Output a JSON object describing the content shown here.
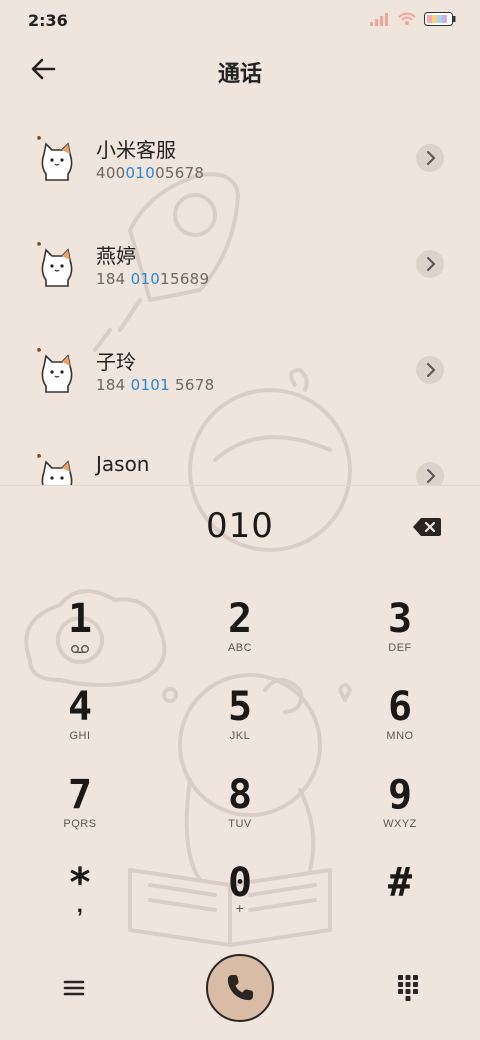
{
  "status_bar": {
    "time": "2:36",
    "icons": [
      "signal-icon",
      "wifi-icon",
      "battery-icon"
    ]
  },
  "header": {
    "title": "通话",
    "back_icon": "back-arrow-icon"
  },
  "contacts": [
    {
      "name": "小米客服",
      "number_before": "400",
      "number_match": "010",
      "number_after": "05678"
    },
    {
      "name": "燕婷",
      "number_before": "184 ",
      "number_match": "010",
      "number_after": "15689"
    },
    {
      "name": "子玲",
      "number_before": "184 ",
      "number_match": "0101",
      "number_after": " 5678"
    },
    {
      "name": "Jason",
      "number_before": "",
      "number_match": "",
      "number_after": ""
    }
  ],
  "dial_input": {
    "value": "010",
    "backspace_icon": "backspace-icon"
  },
  "keypad": [
    {
      "digit": "1",
      "letters": "voicemail-icon"
    },
    {
      "digit": "2",
      "letters": "ABC"
    },
    {
      "digit": "3",
      "letters": "DEF"
    },
    {
      "digit": "4",
      "letters": "GHI"
    },
    {
      "digit": "5",
      "letters": "JKL"
    },
    {
      "digit": "6",
      "letters": "MNO"
    },
    {
      "digit": "7",
      "letters": "PQRS"
    },
    {
      "digit": "8",
      "letters": "TUV"
    },
    {
      "digit": "9",
      "letters": "WXYZ"
    },
    {
      "digit": "*",
      "letters": ","
    },
    {
      "digit": "0",
      "letters": "+"
    },
    {
      "digit": "#",
      "letters": ""
    }
  ],
  "bottom_bar": {
    "menu_icon": "menu-icon",
    "call_icon": "phone-icon",
    "keypad_icon": "keypad-icon"
  },
  "colors": {
    "background": "#efe5dd",
    "match_highlight": "#2b87d8",
    "call_button": "#d8bca6"
  }
}
